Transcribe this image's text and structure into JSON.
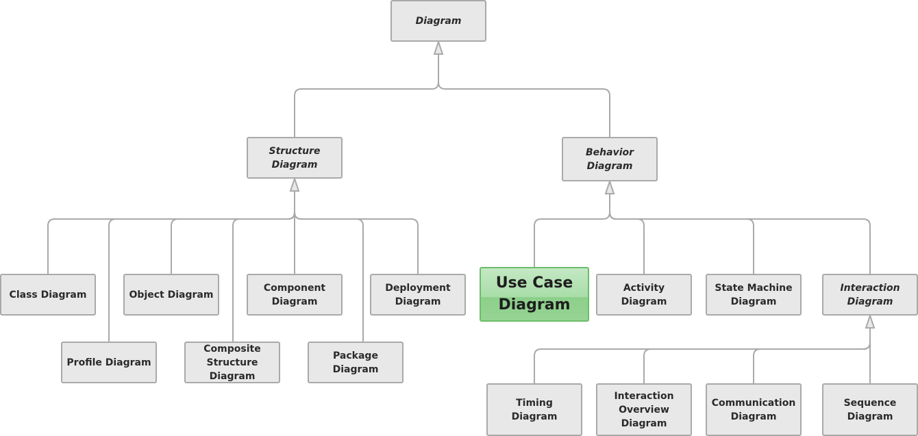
{
  "diagram": {
    "colors": {
      "node_fill": "#e8e8e8",
      "node_border": "#a9a9a9",
      "connector": "#a9a9a9",
      "highlight_fill": "#a9dda8",
      "highlight_border": "#6bbd69"
    },
    "nodes": {
      "diagram": {
        "label": "Diagram",
        "abstract": true
      },
      "structure": {
        "label": "Structure\nDiagram",
        "abstract": true
      },
      "behavior": {
        "label": "Behavior\nDiagram",
        "abstract": true
      },
      "class": {
        "label": "Class Diagram"
      },
      "profile": {
        "label": "Profile Diagram"
      },
      "object": {
        "label": "Object Diagram"
      },
      "composite": {
        "label": "Composite\nStructure\nDiagram"
      },
      "component": {
        "label": "Component\nDiagram"
      },
      "package": {
        "label": "Package Diagram"
      },
      "deployment": {
        "label": "Deployment\nDiagram"
      },
      "usecase": {
        "label": "Use Case\nDiagram",
        "highlighted": true
      },
      "activity": {
        "label": "Activity Diagram"
      },
      "statemachine": {
        "label": "State Machine\nDiagram"
      },
      "interaction": {
        "label": "Interaction\nDiagram",
        "abstract": true
      },
      "timing": {
        "label": "Timing Diagram"
      },
      "interactionoverview": {
        "label": "Interaction\nOverview\nDiagram"
      },
      "communication": {
        "label": "Communication\nDiagram"
      },
      "sequence": {
        "label": "Sequence\nDiagram"
      }
    },
    "edges": [
      [
        "structure",
        "diagram"
      ],
      [
        "behavior",
        "diagram"
      ],
      [
        "class",
        "structure"
      ],
      [
        "profile",
        "structure"
      ],
      [
        "object",
        "structure"
      ],
      [
        "composite",
        "structure"
      ],
      [
        "component",
        "structure"
      ],
      [
        "package",
        "structure"
      ],
      [
        "deployment",
        "structure"
      ],
      [
        "usecase",
        "behavior"
      ],
      [
        "activity",
        "behavior"
      ],
      [
        "statemachine",
        "behavior"
      ],
      [
        "interaction",
        "behavior"
      ],
      [
        "timing",
        "interaction"
      ],
      [
        "interactionoverview",
        "interaction"
      ],
      [
        "communication",
        "interaction"
      ],
      [
        "sequence",
        "interaction"
      ]
    ],
    "edge_type": "generalization"
  }
}
